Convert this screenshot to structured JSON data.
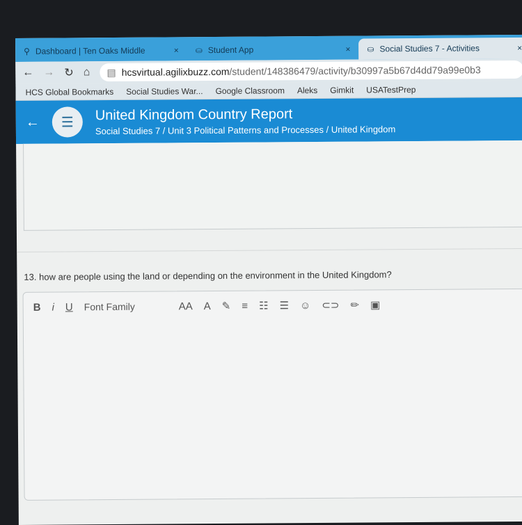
{
  "tabs": [
    {
      "label": "Dashboard | Ten Oaks Middle",
      "icon": "location-pin-icon"
    },
    {
      "label": "Student App",
      "icon": "app-icon"
    },
    {
      "label": "Social Studies 7 - Activities",
      "icon": "app-icon",
      "active": true
    }
  ],
  "address": {
    "host": "hcsvirtual.agilixbuzz.com",
    "path": "/student/148386479/activity/b30997a5b67d4dd79a99e0b3"
  },
  "bookmarks": [
    "HCS Global Bookmarks",
    "Social Studies War...",
    "Google Classroom",
    "Aleks",
    "Gimkit",
    "USATestPrep"
  ],
  "header": {
    "title": "United Kingdom Country Report",
    "breadcrumb": "Social Studies 7 / Unit 3 Political Patterns and Processes / United Kingdom",
    "color": "#1a8bd4"
  },
  "question": "13. how are people using the land or depending on the environment in the United Kingdom?",
  "toolbar": {
    "bold": "B",
    "italic": "i",
    "underline": "U",
    "font_family": "Font Family",
    "font_size": "AA"
  }
}
